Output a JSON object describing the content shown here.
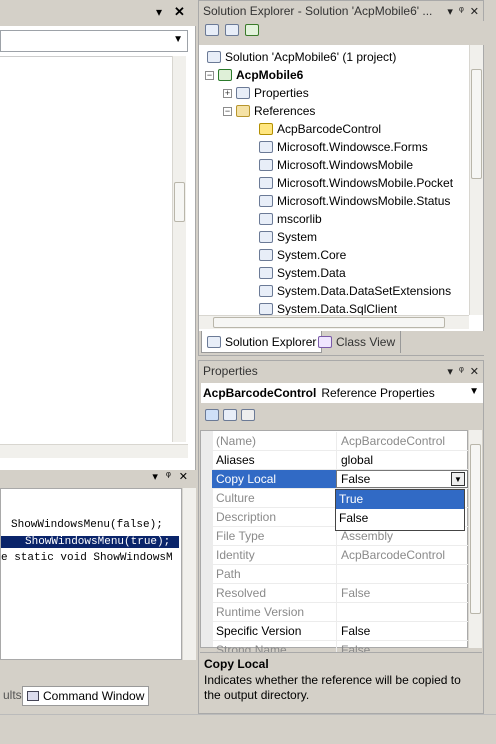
{
  "left": {
    "top_pane_icons": {
      "dropdown": "▾",
      "close": "✕"
    },
    "bottom_pane": {
      "code_lines": [
        "ShowWindowsMenu(false);",
        "ShowWindowsMenu(true);",
        "e static void ShowWindowsM"
      ],
      "tabs": [
        "ults",
        "Command Window"
      ]
    }
  },
  "solution_explorer": {
    "title": "Solution Explorer - Solution 'AcpMobile6' ...",
    "tree": {
      "solution": "Solution 'AcpMobile6' (1 project)",
      "project": "AcpMobile6",
      "properties": "Properties",
      "references": "References",
      "refs": [
        "AcpBarcodeControl",
        "Microsoft.Windowsce.Forms",
        "Microsoft.WindowsMobile",
        "Microsoft.WindowsMobile.Pocket",
        "Microsoft.WindowsMobile.Status",
        "mscorlib",
        "System",
        "System.Core",
        "System.Data",
        "System.Data.DataSetExtensions",
        "System.Data.SqlClient"
      ]
    },
    "tabs": [
      "Solution Explorer",
      "Class View"
    ]
  },
  "properties": {
    "title": "Properties",
    "object_name": "AcpBarcodeControl",
    "object_type": "Reference Properties",
    "rows": [
      {
        "name": "(Name)",
        "value": "AcpBarcodeControl",
        "grey": true
      },
      {
        "name": "Aliases",
        "value": "global",
        "grey": false
      },
      {
        "name": "Copy Local",
        "value": "False",
        "grey": false,
        "selected": true
      },
      {
        "name": "Culture",
        "value": "",
        "grey": true
      },
      {
        "name": "Description",
        "value": "",
        "grey": true
      },
      {
        "name": "File Type",
        "value": "Assembly",
        "grey": true
      },
      {
        "name": "Identity",
        "value": "AcpBarcodeControl",
        "grey": true
      },
      {
        "name": "Path",
        "value": "",
        "grey": true
      },
      {
        "name": "Resolved",
        "value": "False",
        "grey": true
      },
      {
        "name": "Runtime Version",
        "value": "",
        "grey": true
      },
      {
        "name": "Specific Version",
        "value": "False",
        "grey": false
      },
      {
        "name": "Strong Name",
        "value": "False",
        "grey": true
      }
    ],
    "dropdown_options": [
      "True",
      "False"
    ],
    "description_title": "Copy Local",
    "description_text": "Indicates whether the reference will be copied to the output directory."
  }
}
